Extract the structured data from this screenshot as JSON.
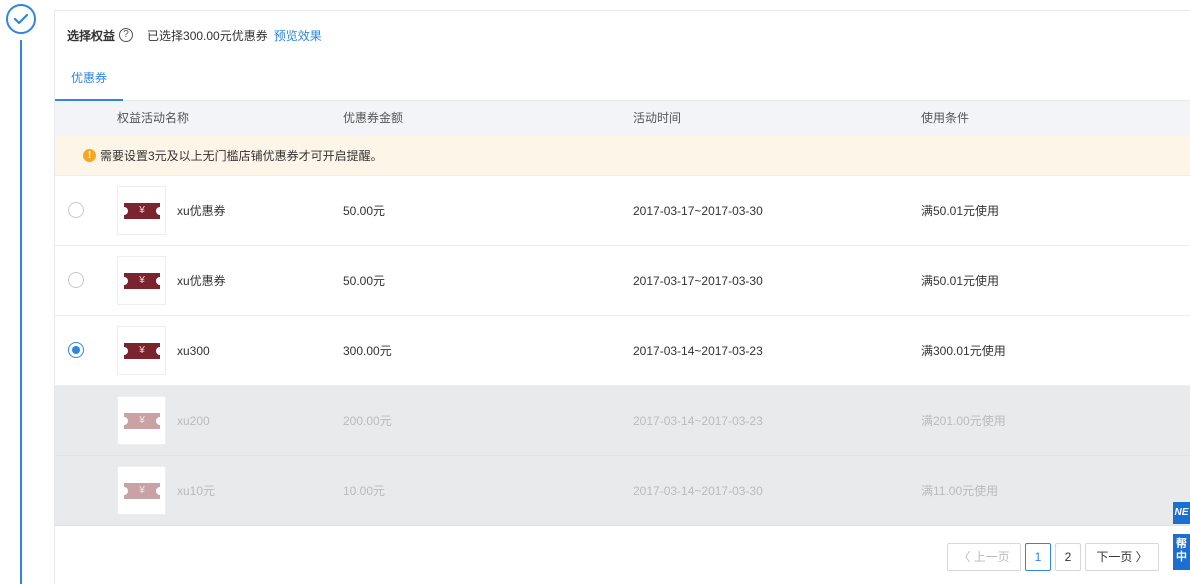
{
  "header": {
    "title": "选择权益",
    "help_glyph": "?",
    "selected_text": "已选择300.00元优惠券",
    "preview_link": "预览效果"
  },
  "tabs": [
    {
      "label": "优惠券",
      "active": true
    }
  ],
  "table": {
    "columns": [
      "权益活动名称",
      "优惠券金额",
      "活动时间",
      "使用条件"
    ],
    "notice": "需要设置3元及以上无门槛店铺优惠券才可开启提醒。",
    "notice_glyph": "!",
    "coupon_glyph": "¥",
    "rows": [
      {
        "name": "xu优惠券",
        "amount": "50.00元",
        "time": "2017-03-17~2017-03-30",
        "condition": "满50.01元使用",
        "selected": false,
        "disabled": false
      },
      {
        "name": "xu优惠券",
        "amount": "50.00元",
        "time": "2017-03-17~2017-03-30",
        "condition": "满50.01元使用",
        "selected": false,
        "disabled": false
      },
      {
        "name": "xu300",
        "amount": "300.00元",
        "time": "2017-03-14~2017-03-23",
        "condition": "满300.01元使用",
        "selected": true,
        "disabled": false
      },
      {
        "name": "xu200",
        "amount": "200.00元",
        "time": "2017-03-14~2017-03-23",
        "condition": "满201.00元使用",
        "selected": false,
        "disabled": true
      },
      {
        "name": "xu10元",
        "amount": "10.00元",
        "time": "2017-03-14~2017-03-30",
        "condition": "满11.00元使用",
        "selected": false,
        "disabled": true
      }
    ]
  },
  "pagination": {
    "prev": "〈 上一页",
    "pages": [
      "1",
      "2"
    ],
    "current": "1",
    "next": "下一页 〉"
  },
  "side_widgets": {
    "new_label": "NE",
    "help_label_1": "帮",
    "help_label_2": "中"
  },
  "colors": {
    "accent": "#2e86de",
    "coupon": "#7a2430",
    "notice_bg": "#fdf6e8",
    "warning": "#f5a623"
  }
}
